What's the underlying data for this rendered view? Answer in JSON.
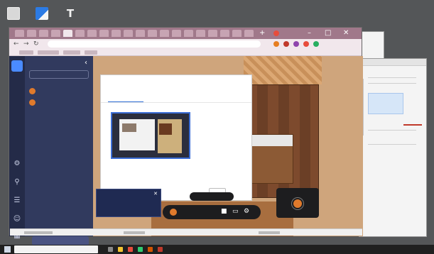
{
  "desktop": {
    "icons": [
      {
        "name": "recycle-bin-icon"
      },
      {
        "name": "app-shortcut-icon"
      },
      {
        "name": "terminal-icon",
        "glyph": "T"
      }
    ]
  },
  "browser": {
    "tabs_count": 20,
    "new_tab_glyph": "+",
    "controls": {
      "minimize": "–",
      "maximize": "□",
      "close": "✕"
    },
    "url": "",
    "nav": {
      "back": "←",
      "forward": "→",
      "reload": "↻"
    }
  },
  "sidebar": {
    "logo": "",
    "title": "",
    "collapse_glyph": "‹",
    "search_placeholder": "",
    "users": [
      {
        "label": "",
        "color": "#e07a2c"
      },
      {
        "label": "",
        "color": "#e07a2c"
      }
    ],
    "bottom_button": "",
    "rail_icons": [
      "gear-icon",
      "link-icon",
      "chat-icon",
      "people-icon",
      "grid-icon"
    ]
  },
  "dialog": {
    "title": "",
    "subtitle": "",
    "tabs": [
      "",
      "",
      ""
    ],
    "footer_text": "",
    "cancel_label": "",
    "share_label": ""
  },
  "shelf_card": {
    "header": ""
  },
  "notification": {
    "title": "",
    "close_glyph": "✕",
    "body": ""
  },
  "callbar": {
    "tooltip": "",
    "label": ""
  },
  "mini_video": {
    "name": ""
  },
  "status": {
    "left": "",
    "right": ""
  },
  "taskbar": {
    "search_placeholder": "",
    "tray_text": ""
  }
}
